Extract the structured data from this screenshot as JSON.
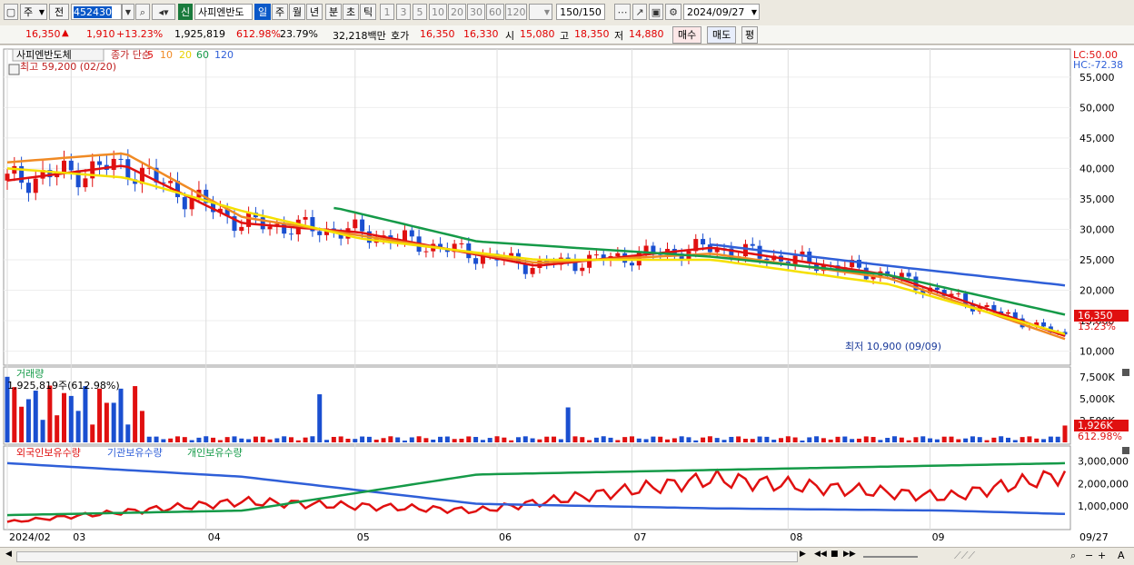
{
  "toolbar": {
    "type_select": "주",
    "market_select": "전",
    "code": "452430",
    "badge": "신",
    "name": "사피엔반도",
    "periods": [
      "일",
      "주",
      "월",
      "년",
      "분",
      "초",
      "틱"
    ],
    "intervals": [
      "1",
      "3",
      "5",
      "10",
      "20",
      "30",
      "60",
      "120"
    ],
    "count": "150",
    "count_total": "/150",
    "date": "2024/09/27"
  },
  "quote": {
    "price": "16,350",
    "change": "1,910",
    "change_pct": "+13.23%",
    "volume": "1,925,819",
    "volume_ratio": "612.98%",
    "turnover": "23.79%",
    "amount": "32,218백만",
    "bid_label": "호가",
    "ask": "16,350",
    "bid": "16,330",
    "open_label": "시",
    "open": "15,080",
    "high_label": "고",
    "high": "18,350",
    "low_label": "저",
    "low": "14,880",
    "buy_label": "매수",
    "sell_label": "매도",
    "eval_label": "평"
  },
  "price_panel": {
    "stock_name": "사피엔반도체",
    "legend_label": "종가 단순",
    "ma_periods": [
      "5",
      "10",
      "20",
      "60",
      "120"
    ],
    "ma_colors": [
      "#e01010",
      "#f08a24",
      "#f5e000",
      "#159a48",
      "#2f5fd8"
    ],
    "high_note": "최고 59,200 (02/20)",
    "low_note": "최저 10,900 (09/09)",
    "lc": "LC:50.00",
    "hc": "HC:-72.38",
    "price_axis": [
      "55,000",
      "50,000",
      "45,000",
      "40,000",
      "35,000",
      "30,000",
      "25,000",
      "20,000",
      "15,000",
      "10,000"
    ],
    "last_price": "16,350",
    "last_change": "13.23%"
  },
  "volume_panel": {
    "title": "거래량",
    "info": "1,925,819주(612.98%)",
    "axis": [
      "7,500K",
      "5,000K",
      "2,500K"
    ],
    "last_volume": "1,926K",
    "last_ratio": "612.98%"
  },
  "holding_panel": {
    "series_labels": [
      "외국인보유수량",
      "기관보유수량",
      "개인보유수량"
    ],
    "series_colors": [
      "#e01010",
      "#2f5fd8",
      "#159a48"
    ],
    "axis": [
      "3,000,000",
      "2,000,000",
      "1,000,000"
    ]
  },
  "date_axis": [
    "2024/02",
    "03",
    "04",
    "05",
    "06",
    "07",
    "08",
    "09"
  ],
  "date_axis_end": "09/27",
  "status": {
    "zoom_minus": "−",
    "zoom_plus": "+",
    "font_label": "A"
  },
  "chart_data": {
    "type": "line",
    "price_ma": [
      {
        "name": "5",
        "color": "#e01010",
        "x": [
          0,
          10,
          20,
          30,
          45,
          60,
          75,
          90
        ],
        "values": [
          38000,
          40500,
          31000,
          29500,
          24000,
          27000,
          22500,
          12500
        ]
      },
      {
        "name": "10",
        "color": "#f08a24",
        "x": [
          0,
          10,
          20,
          30,
          45,
          60,
          75,
          90
        ],
        "values": [
          41000,
          42500,
          32000,
          29000,
          24500,
          26000,
          22000,
          12000
        ]
      },
      {
        "name": "20",
        "color": "#f5e000",
        "x": [
          0,
          10,
          20,
          30,
          45,
          60,
          75,
          90
        ],
        "values": [
          40000,
          38500,
          33000,
          28500,
          25000,
          25000,
          21000,
          12800
        ]
      },
      {
        "name": "60",
        "color": "#159a48",
        "x": [
          28,
          40,
          60,
          75,
          90
        ],
        "values": [
          33500,
          28000,
          25500,
          22500,
          16000
        ]
      },
      {
        "name": "120",
        "color": "#2f5fd8",
        "x": [
          60,
          75,
          90
        ],
        "values": [
          27500,
          24000,
          20800
        ]
      }
    ],
    "price_range": [
      8000,
      59000
    ],
    "holdings": [
      {
        "name": "외국인보유수량",
        "color": "#e01010",
        "x": [
          0,
          20,
          40,
          60,
          80,
          90
        ],
        "values": [
          300000,
          1200000,
          800000,
          2200000,
          1400000,
          2400000
        ]
      },
      {
        "name": "기관보유수량",
        "color": "#2f5fd8",
        "x": [
          0,
          20,
          40,
          60,
          80,
          90
        ],
        "values": [
          2900000,
          2300000,
          1100000,
          900000,
          800000,
          650000
        ]
      },
      {
        "name": "개인보유수량",
        "color": "#159a48",
        "x": [
          0,
          20,
          40,
          60,
          80,
          90
        ],
        "values": [
          600000,
          800000,
          2400000,
          2600000,
          2800000,
          2900000
        ]
      }
    ]
  }
}
